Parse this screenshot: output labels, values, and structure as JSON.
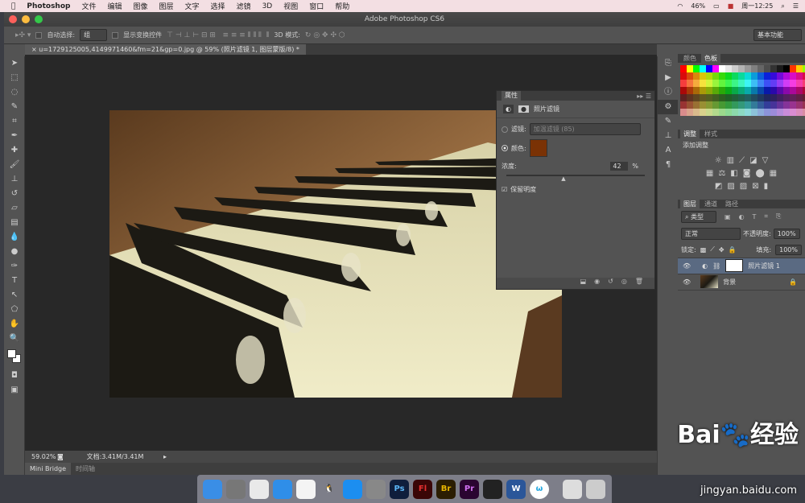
{
  "menubar": {
    "app": "Photoshop",
    "items": [
      "文件",
      "编辑",
      "图像",
      "图层",
      "文字",
      "选择",
      "滤镜",
      "3D",
      "视图",
      "窗口",
      "帮助"
    ],
    "battery": "46%",
    "clock": "周一12:25"
  },
  "window": {
    "title": "Adobe Photoshop CS6"
  },
  "options": {
    "auto_select": "自动选择:",
    "auto_select_value": "组",
    "show_transform": "显示变换控件",
    "mode_3d": "3D 模式:",
    "workspace": "基本功能"
  },
  "document": {
    "tab": "u=1729125005,4149971460&fm=21&gp=0.jpg @ 59% (照片滤镜 1, 图层蒙版/8) *",
    "zoom": "59.02%",
    "doc_size": "文档:3.41M/3.41M"
  },
  "bottom_tabs": [
    "Mini Bridge",
    "时间轴"
  ],
  "properties": {
    "title": "属性",
    "panel_name": "照片滤镜",
    "filter_label": "滤镜:",
    "filter_value": "加温滤镜 (85)",
    "color_label": "颜色:",
    "color": "#7a3205",
    "density_label": "浓度:",
    "density": "42",
    "percent": "%",
    "preserve": "保留明度",
    "preserve_checked": true
  },
  "color_panel": {
    "tabs": [
      "颜色",
      "色板"
    ],
    "active": "色板"
  },
  "adjust_panel": {
    "tabs": [
      "调整",
      "样式"
    ],
    "heading": "添加调整"
  },
  "layers_panel": {
    "tabs": [
      "图层",
      "通道",
      "路径"
    ],
    "kind": "类型",
    "blend": "正常",
    "opacity_label": "不透明度:",
    "opacity": "100%",
    "lock_label": "锁定:",
    "fill_label": "填充:",
    "fill": "100%",
    "layers": [
      {
        "name": "照片滤镜 1",
        "selected": true
      },
      {
        "name": "背景",
        "locked": true
      }
    ]
  },
  "dock": [
    "Finder",
    "Launchpad",
    "Chrome",
    "Safari",
    "Photos",
    "QQ",
    "App Store",
    "System Preferences",
    "Ps",
    "Fl",
    "Br",
    "Pr",
    "QuickTime",
    "Word",
    "W",
    "Preview",
    "Trash"
  ],
  "watermark": {
    "logo": "Bai du 经验",
    "url": "jingyan.baidu.com"
  }
}
